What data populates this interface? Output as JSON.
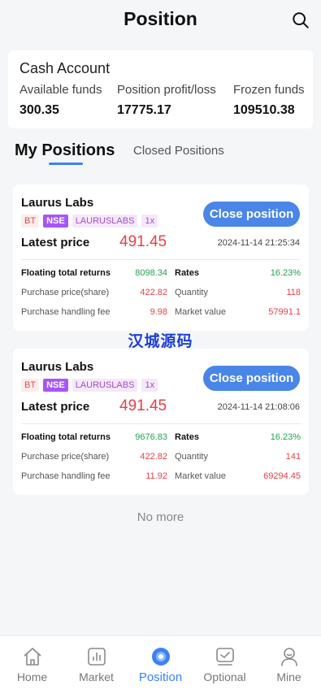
{
  "header": {
    "title": "Position",
    "search_icon": "search-icon"
  },
  "cash": {
    "title": "Cash Account",
    "available_label": "Available funds",
    "available_value": "300.35",
    "profit_label": "Position profit/loss",
    "profit_value": "17775.17",
    "frozen_label": "Frozen funds",
    "frozen_value": "109510.38"
  },
  "tabs": {
    "active": "My Positions",
    "inactive": "Closed Positions"
  },
  "positions": [
    {
      "name": "Laurus Labs",
      "tags": [
        "BT",
        "NSE",
        "LAURUSLABS",
        "1x"
      ],
      "close_label": "Close position",
      "latest_label": "Latest price",
      "latest_price": "491.45",
      "time": "2024-11-14 21:25:34",
      "floating_label": "Floating total returns",
      "floating_value": "8098.34",
      "rates_label": "Rates",
      "rates_value": "16.23%",
      "purchase_price_label": "Purchase price(share)",
      "purchase_price": "422.82",
      "quantity_label": "Quantity",
      "quantity": "118",
      "fee_label": "Purchase handling fee",
      "fee": "9.98",
      "market_label": "Market value",
      "market_value": "57991.1"
    },
    {
      "name": "Laurus Labs",
      "tags": [
        "BT",
        "NSE",
        "LAURUSLABS",
        "1x"
      ],
      "close_label": "Close position",
      "latest_label": "Latest price",
      "latest_price": "491.45",
      "time": "2024-11-14 21:08:06",
      "floating_label": "Floating total returns",
      "floating_value": "9676.83",
      "rates_label": "Rates",
      "rates_value": "16.23%",
      "purchase_price_label": "Purchase price(share)",
      "purchase_price": "422.82",
      "quantity_label": "Quantity",
      "quantity": "141",
      "fee_label": "Purchase handling fee",
      "fee": "11.92",
      "market_label": "Market value",
      "market_value": "69294.45"
    }
  ],
  "watermark": "汉城源码",
  "no_more": "No more",
  "tabbar": [
    {
      "label": "Home",
      "icon": "home-icon"
    },
    {
      "label": "Market",
      "icon": "market-icon"
    },
    {
      "label": "Position",
      "icon": "position-icon",
      "active": true
    },
    {
      "label": "Optional",
      "icon": "optional-icon"
    },
    {
      "label": "Mine",
      "icon": "mine-icon"
    }
  ],
  "colors": {
    "accent": "#3b82f6",
    "button": "#4a86e8",
    "loss_red": "#e8404a",
    "gain_green": "#22a34f",
    "nse_purple": "#a855f7"
  }
}
